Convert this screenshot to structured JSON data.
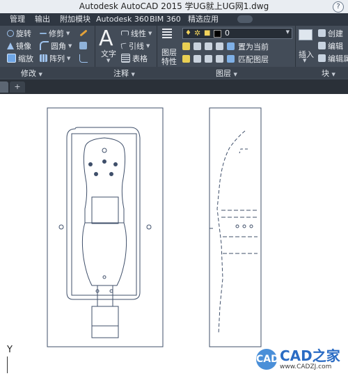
{
  "window": {
    "title": "Autodesk AutoCAD 2015    学UG就上UG网1.dwg",
    "help_glyph": "?"
  },
  "menu": {
    "items": [
      "管理",
      "输出",
      "附加模块",
      "Autodesk 360",
      "BIM 360",
      "精选应用"
    ]
  },
  "ribbon": {
    "modify": {
      "rotate": "旋转",
      "move": "修剪",
      "mirror": "镜像",
      "fillet": "圆角",
      "scale": "缩放",
      "array": "阵列"
    },
    "annotation": {
      "text": "文字",
      "linear": "线性",
      "leader": "引线",
      "table": "表格"
    },
    "layers": {
      "properties": "图层\n特性",
      "current_layer": "0",
      "make_current": "置为当前",
      "match_layer": "匹配图层"
    },
    "block": {
      "insert": "插入",
      "create": "创建",
      "edit": "编辑",
      "edit_attr": "编辑属"
    },
    "group_labels": [
      "修改",
      "注释",
      "图层",
      "块"
    ]
  },
  "tabs": {
    "plus": "+"
  },
  "canvas": {
    "ucs_y": "Y"
  },
  "watermark": {
    "logo": "CAD",
    "brand": "CAD之家",
    "url": "www.CADZJ.com"
  },
  "colors": {
    "ribbon_bg": "#434c58",
    "menu_bg": "#2f3742",
    "drawing_lines": "#3f4f6a"
  }
}
